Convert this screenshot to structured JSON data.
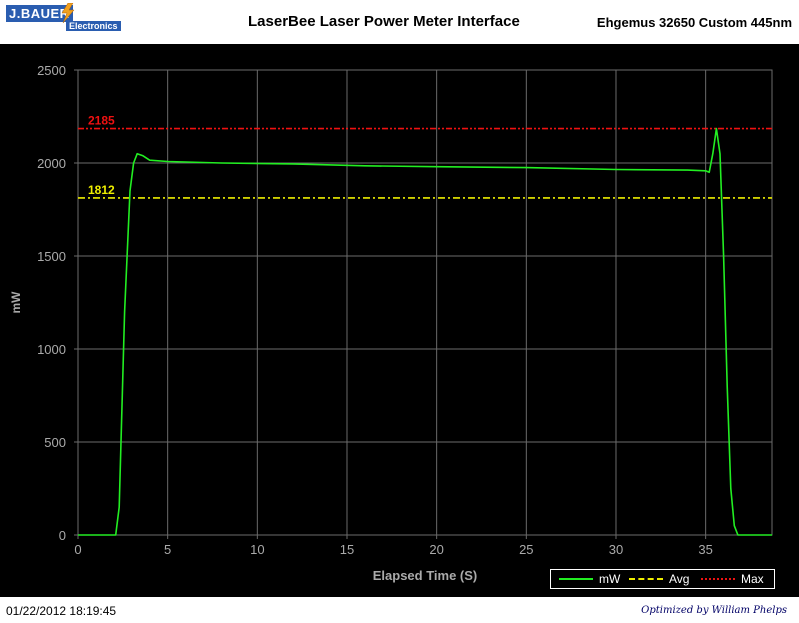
{
  "header": {
    "logo_main": "J.BAUER",
    "logo_sub": "Electronics",
    "title": "LaserBee Laser Power Meter Interface",
    "device": "Ehgemus 32650 Custom 445nm"
  },
  "footer": {
    "timestamp": "01/22/2012 18:19:45",
    "credit": "Optimized by William Phelps"
  },
  "colors": {
    "background": "#000000",
    "grid": "#6b6b6b",
    "axis_text": "#aaaaaa",
    "series_mw": "#22ee22",
    "avg": "#eeee00",
    "max": "#ee1111"
  },
  "chart_data": {
    "type": "line",
    "xlabel": "Elapsed Time (S)",
    "ylabel": "mW",
    "xlim": [
      0,
      38.7
    ],
    "ylim": [
      0,
      2500
    ],
    "x_ticks": [
      0,
      5,
      10,
      15,
      20,
      25,
      30,
      35
    ],
    "y_ticks": [
      0,
      500,
      1000,
      1500,
      2000,
      2500
    ],
    "grid": true,
    "legend_position": "bottom-right",
    "series": [
      {
        "name": "mW",
        "points": [
          [
            0,
            0
          ],
          [
            2.1,
            0
          ],
          [
            2.3,
            150
          ],
          [
            2.6,
            1200
          ],
          [
            2.9,
            1850
          ],
          [
            3.1,
            2000
          ],
          [
            3.3,
            2050
          ],
          [
            3.6,
            2040
          ],
          [
            4.0,
            2015
          ],
          [
            5,
            2008
          ],
          [
            8,
            2000
          ],
          [
            12,
            1995
          ],
          [
            16,
            1985
          ],
          [
            20,
            1980
          ],
          [
            25,
            1975
          ],
          [
            30,
            1965
          ],
          [
            34,
            1962
          ],
          [
            35.0,
            1958
          ],
          [
            35.2,
            1950
          ],
          [
            35.4,
            2050
          ],
          [
            35.6,
            2185
          ],
          [
            35.8,
            2050
          ],
          [
            36.0,
            1500
          ],
          [
            36.2,
            800
          ],
          [
            36.4,
            250
          ],
          [
            36.6,
            50
          ],
          [
            36.8,
            0
          ],
          [
            38.7,
            0
          ]
        ]
      }
    ],
    "reference_lines": [
      {
        "name": "Avg",
        "value": 1812,
        "label": "1812"
      },
      {
        "name": "Max",
        "value": 2185,
        "label": "2185"
      }
    ],
    "legend": [
      {
        "name": "mW",
        "style": "solid"
      },
      {
        "name": "Avg",
        "style": "dash-dot"
      },
      {
        "name": "Max",
        "style": "dash-dot-dot"
      }
    ]
  }
}
